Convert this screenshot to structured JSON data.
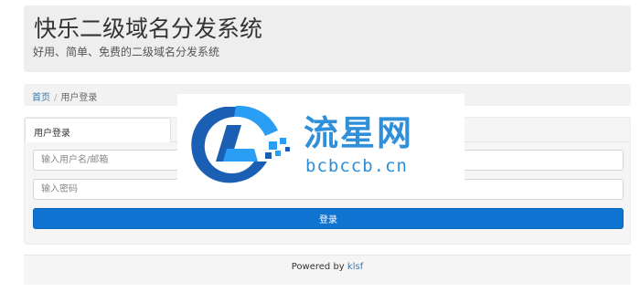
{
  "header": {
    "title": "快乐二级域名分发系统",
    "subtitle": "好用、简单、免费的二级域名分发系统"
  },
  "breadcrumb": {
    "home": "首页",
    "separator": "/",
    "current": "用户登录"
  },
  "login": {
    "tab_label": "用户登录",
    "username_placeholder": "输入用户名/邮箱",
    "password_placeholder": "输入密码",
    "submit_label": "登录"
  },
  "footer": {
    "prefix": "Powered by",
    "link": "klsf"
  },
  "watermark": {
    "text": "流星网",
    "url": "bcbccb.cn"
  },
  "colors": {
    "primary_button": "#0f74d1",
    "link": "#337ab7",
    "watermark": "#2f8fd9"
  }
}
